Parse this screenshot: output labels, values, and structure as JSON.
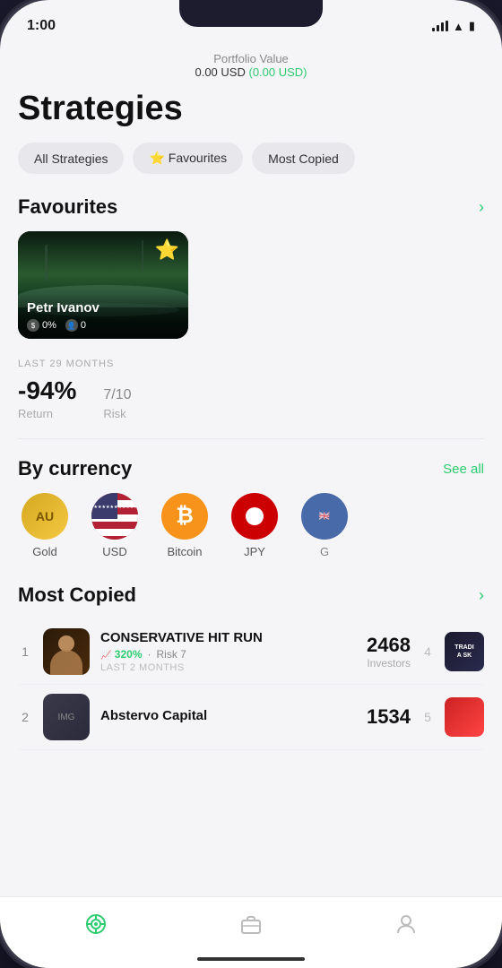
{
  "status": {
    "time": "1:00",
    "location_icon": "›"
  },
  "portfolio": {
    "label": "Portfolio Value",
    "value": "0.00 USD",
    "change": "(0.00 USD)"
  },
  "page": {
    "title": "Strategies"
  },
  "filter_tabs": [
    {
      "id": "all",
      "label": "All Strategies",
      "active": false
    },
    {
      "id": "favourites",
      "label": "⭐ Favourites",
      "active": false
    },
    {
      "id": "most-copied",
      "label": "Most Copied",
      "active": false
    }
  ],
  "favourites": {
    "section_title": "Favourites",
    "card": {
      "name": "Petr Ivanov",
      "profit_pct": "0%",
      "followers": "0",
      "star": "⭐"
    },
    "perf": {
      "duration_label": "LAST 29 MONTHS",
      "return_value": "-94%",
      "return_label": "Return",
      "risk_value": "7",
      "risk_suffix": "/10",
      "risk_label": "Risk"
    }
  },
  "by_currency": {
    "section_title": "By currency",
    "see_all": "See all",
    "items": [
      {
        "id": "gold",
        "label": "Gold",
        "symbol": "AU",
        "icon_class": "icon-gold"
      },
      {
        "id": "usd",
        "label": "USD",
        "symbol": "USD",
        "icon_class": "icon-usd"
      },
      {
        "id": "btc",
        "label": "Bitcoin",
        "symbol": "₿",
        "icon_class": "icon-btc"
      },
      {
        "id": "jpy",
        "label": "JPY",
        "symbol": "●",
        "icon_class": "icon-jpy"
      },
      {
        "id": "gbp",
        "label": "G",
        "symbol": "🏴󠁧󠁢󠁥󠁮󠁧󠁿",
        "icon_class": "icon-gbp"
      }
    ]
  },
  "most_copied": {
    "section_title": "Most Copied",
    "items": [
      {
        "rank": "1",
        "name": "CONSERVATIVE HIT RUN",
        "return_pct": "320%",
        "risk": "7",
        "duration": "LAST 2 MONTHS",
        "investors_count": "2468",
        "investors_label": "Investors",
        "rank_right": "4",
        "trend": "TRADI\nA SK"
      },
      {
        "rank": "2",
        "name": "Abstervo Capital",
        "return_pct": "",
        "risk": "",
        "duration": "",
        "investors_count": "1534",
        "investors_label": "Investors",
        "rank_right": "5",
        "trend": ""
      }
    ]
  },
  "bottom_nav": {
    "items": [
      {
        "id": "strategies",
        "label": "",
        "active": true
      },
      {
        "id": "portfolio",
        "label": "",
        "active": false
      },
      {
        "id": "profile",
        "label": "",
        "active": false
      }
    ]
  }
}
